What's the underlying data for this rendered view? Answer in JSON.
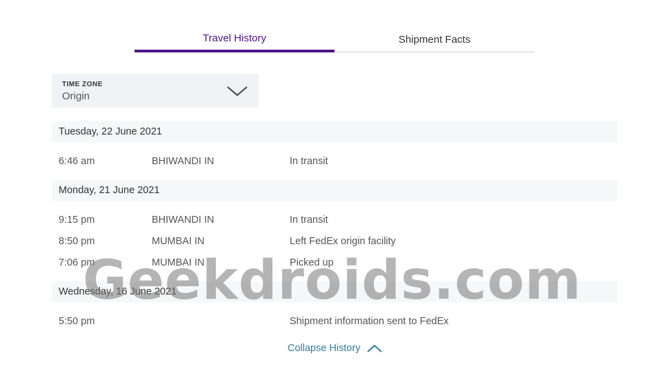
{
  "tabs": [
    {
      "label": "Travel History",
      "active": true
    },
    {
      "label": "Shipment Facts",
      "active": false
    }
  ],
  "time_zone": {
    "label": "TIME ZONE",
    "value": "Origin",
    "icon": "chevron-down-icon"
  },
  "history": [
    {
      "date": "Tuesday, 22 June 2021",
      "events": [
        {
          "time": "6:46 am",
          "location": "BHIWANDI IN",
          "status": "In transit"
        }
      ]
    },
    {
      "date": "Monday, 21 June 2021",
      "events": [
        {
          "time": "9:15 pm",
          "location": "BHIWANDI IN",
          "status": "In transit"
        },
        {
          "time": "8:50 pm",
          "location": "MUMBAI IN",
          "status": "Left FedEx origin facility"
        },
        {
          "time": "7:06 pm",
          "location": "MUMBAI IN",
          "status": "Picked up"
        }
      ]
    },
    {
      "date": "Wednesday, 16 June 2021",
      "events": [
        {
          "time": "5:50 pm",
          "location": "",
          "status": "Shipment information sent to FedEx"
        }
      ]
    }
  ],
  "collapse": {
    "label": "Collapse History",
    "icon": "chevron-up-icon"
  },
  "watermark": "Geekdroids.com",
  "colors": {
    "accent": "#4d148c",
    "link": "#2e7da6"
  }
}
